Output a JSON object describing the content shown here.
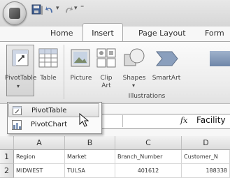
{
  "tabs": [
    "Home",
    "Insert",
    "Page Layout",
    "Form"
  ],
  "ribbon": {
    "pivottable": "PivotTable",
    "table": "Table",
    "picture": "Picture",
    "clip_art_1": "Clip",
    "clip_art_2": "Art",
    "shapes": "Shapes",
    "smartart": "SmartArt",
    "group_label": "Illustrations"
  },
  "menu": {
    "pivottable": "PivotTable",
    "pivotchart": "PivotChart"
  },
  "formula": {
    "fx": "fx",
    "value": "Facility"
  },
  "columns": [
    "A",
    "B",
    "C",
    "D"
  ],
  "rows": [
    {
      "num": "1",
      "cells": [
        "Region",
        "Market",
        "Branch_Number",
        "Customer_N"
      ]
    },
    {
      "num": "2",
      "cells": [
        "MIDWEST",
        "TULSA",
        "401612",
        "188338"
      ]
    }
  ]
}
